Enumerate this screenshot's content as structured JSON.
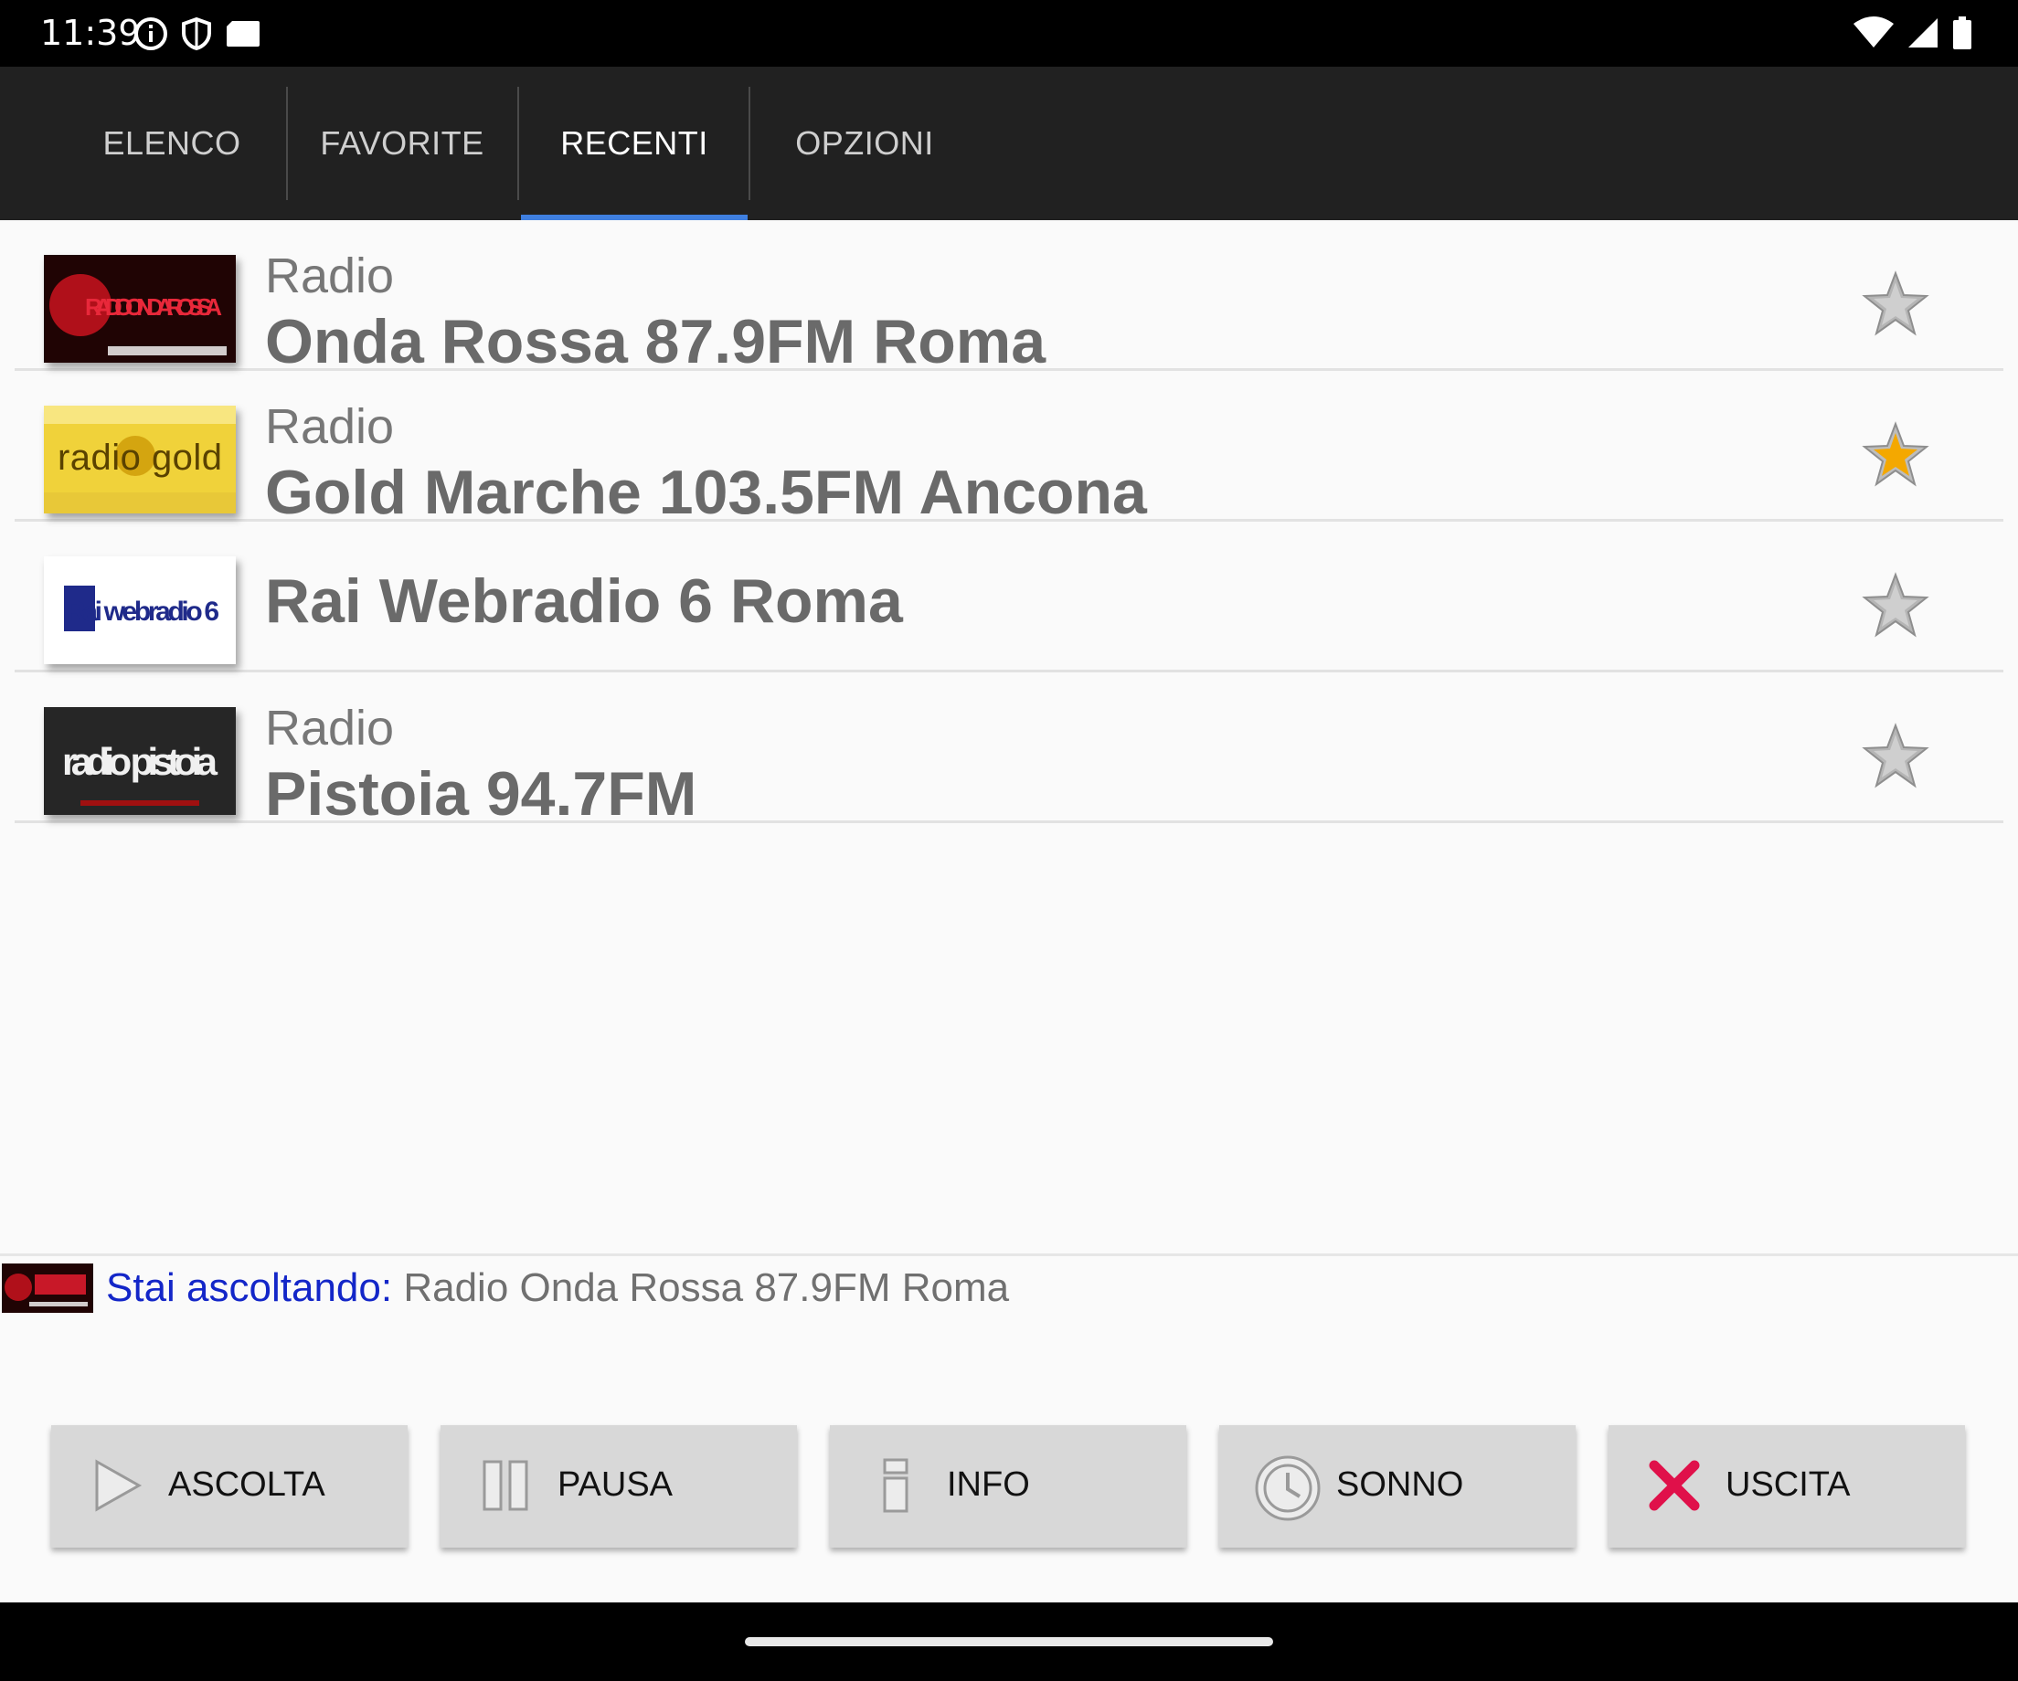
{
  "status_bar": {
    "time": "11:39",
    "left_icons": [
      "info-icon",
      "shield-icon",
      "card-icon"
    ],
    "right_icons": [
      "wifi-icon",
      "signal-icon",
      "battery-icon"
    ]
  },
  "tabs": [
    {
      "label": "ELENCO",
      "active": false
    },
    {
      "label": "FAVORITE",
      "active": false
    },
    {
      "label": "RECENTI",
      "active": true
    },
    {
      "label": "OPZIONI",
      "active": false
    }
  ],
  "stations": [
    {
      "prefix": "Radio",
      "name": "Onda Rossa 87.9FM Roma",
      "logo": "RADIO ONDAROSSA",
      "favorite": false
    },
    {
      "prefix": "Radio",
      "name": "Gold Marche 103.5FM Ancona",
      "logo": "radio gold",
      "favorite": true
    },
    {
      "prefix": "",
      "name": "Rai Webradio 6 Roma",
      "logo": "Rai webradio 6",
      "favorite": false
    },
    {
      "prefix": "Radio",
      "name": "Pistoia 94.7FM",
      "logo": "radio pistoia",
      "favorite": false
    }
  ],
  "now_playing": {
    "label": "Stai ascoltando:",
    "value": "Radio Onda Rossa 87.9FM Roma"
  },
  "buttons": [
    {
      "label": "ASCOLTA",
      "icon": "play-icon"
    },
    {
      "label": "PAUSA",
      "icon": "pause-icon"
    },
    {
      "label": "INFO",
      "icon": "info-icon"
    },
    {
      "label": "SONNO",
      "icon": "clock-icon"
    },
    {
      "label": "USCITA",
      "icon": "close-icon"
    }
  ],
  "colors": {
    "tab_indicator": "#3f7fe0",
    "now_playing_label": "#1326c8",
    "favorite_star": "#f4a800",
    "exit_icon": "#e0104a"
  }
}
